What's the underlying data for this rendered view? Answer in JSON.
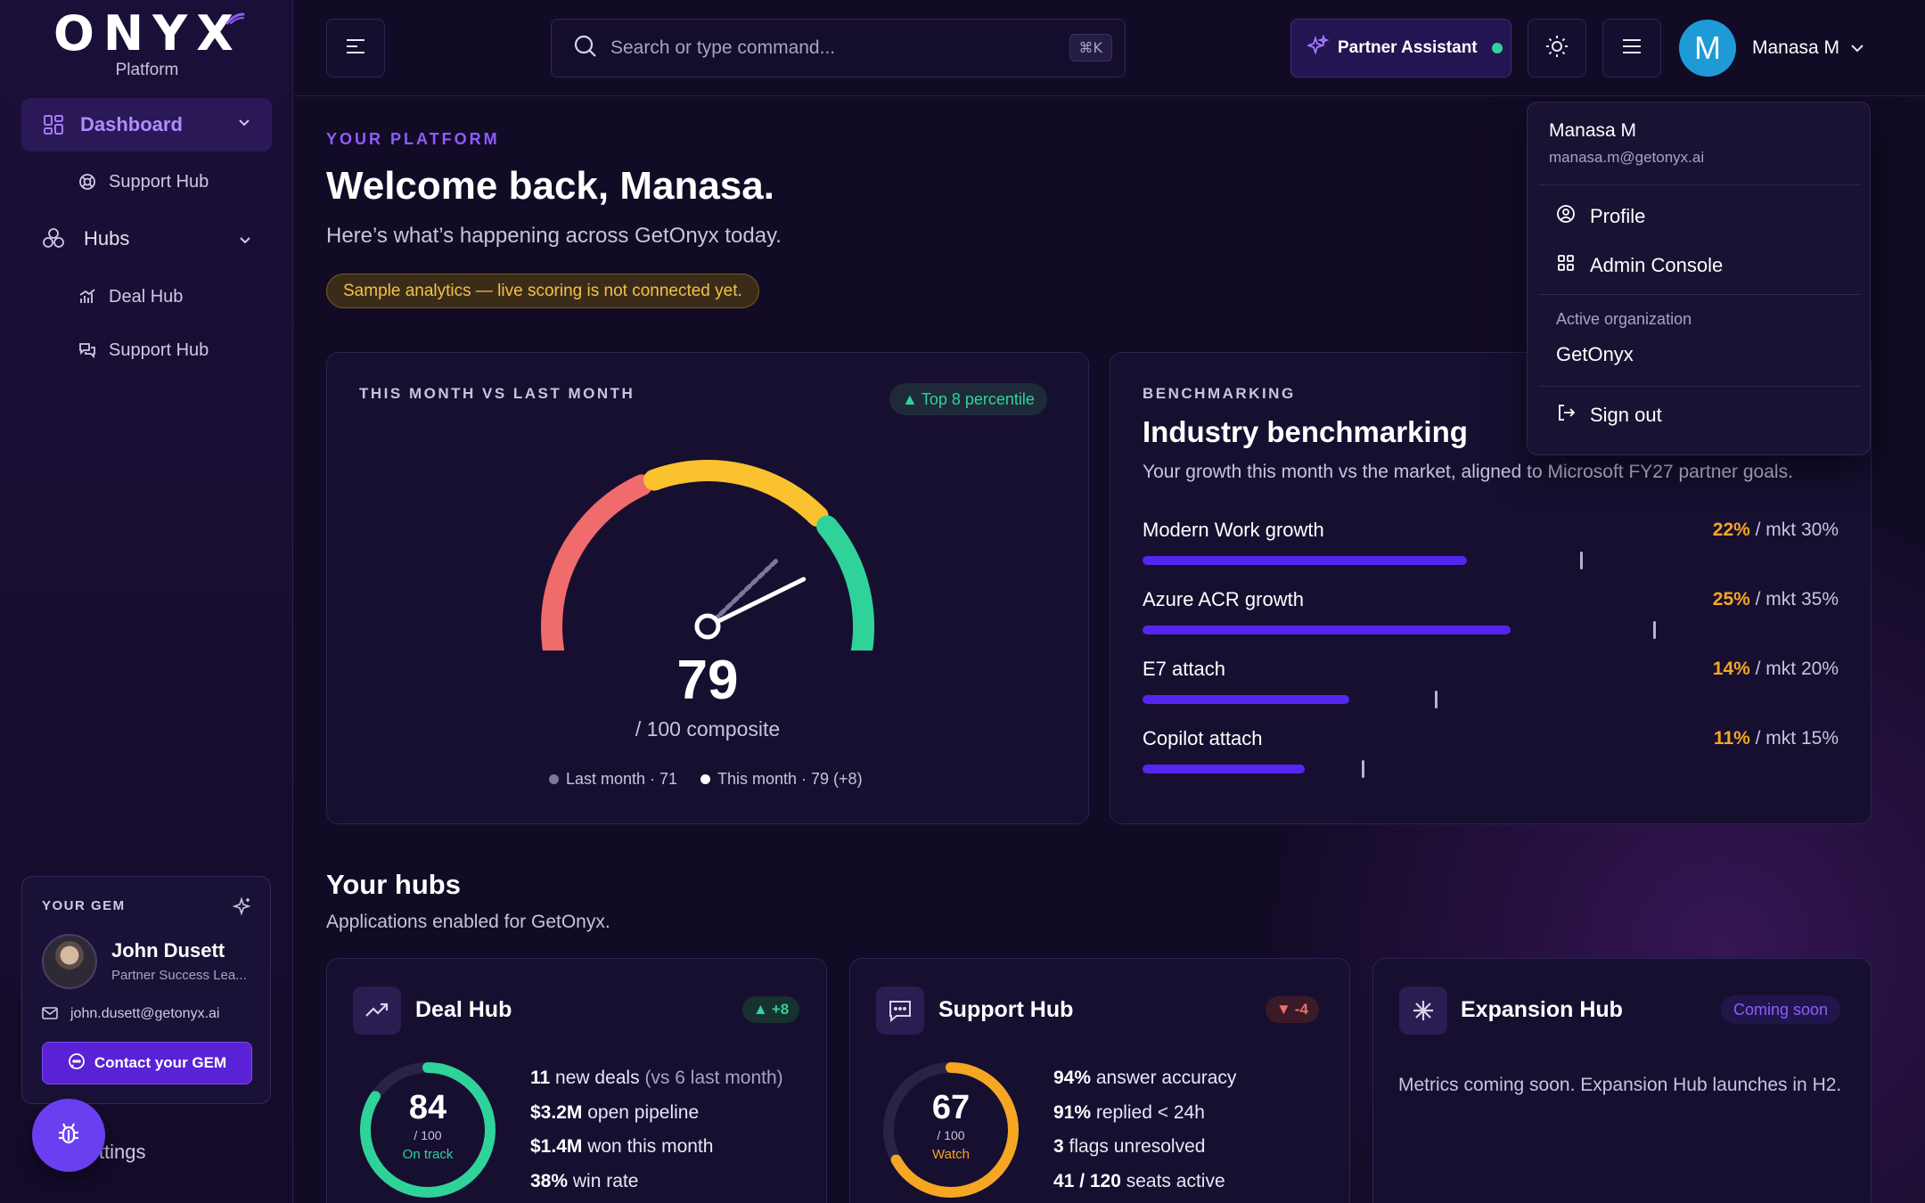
{
  "brand": {
    "name": "ONYX",
    "subtitle": "Platform"
  },
  "sidebar": {
    "items": [
      {
        "label": "Dashboard",
        "icon": "dashboard-grid-icon",
        "active": true
      },
      {
        "label": "Support Hub",
        "icon": "lifebuoy-icon"
      },
      {
        "label": "Hubs",
        "icon": "hubs-cluster-icon"
      },
      {
        "label": "Deal Hub",
        "icon": "bar-chart-icon"
      },
      {
        "label": "Support Hub",
        "icon": "chat-bubbles-icon"
      }
    ],
    "settings_label": "Settings",
    "gem": {
      "title": "YOUR GEM",
      "name": "John Dusett",
      "role": "Partner Success Lea...",
      "email": "john.dusett@getonyx.ai",
      "button": "Contact your GEM"
    }
  },
  "topbar": {
    "search_placeholder": "Search or type command...",
    "shortcut": "⌘K",
    "partner_assistant": "Partner Assistant",
    "user_initial": "M",
    "user_name": "Manasa M"
  },
  "dropdown": {
    "name": "Manasa M",
    "email": "manasa.m@getonyx.ai",
    "profile": "Profile",
    "admin": "Admin Console",
    "org_label": "Active organization",
    "org_name": "GetOnyx",
    "signout": "Sign out"
  },
  "hero": {
    "eyebrow": "YOUR PLATFORM",
    "title": "Welcome back, Manasa.",
    "subtitle": "Here’s what’s happening across GetOnyx today.",
    "notice": "Sample analytics — live scoring is not connected yet."
  },
  "composite": {
    "eyebrow": "THIS MONTH VS LAST MONTH",
    "badge": "Top 8 percentile",
    "score": "79",
    "score_sub": "/ 100 composite",
    "score_value": 79,
    "last_value": 71,
    "legend_last": "Last month · 71",
    "legend_this": "This month · 79 (+8)",
    "colors": {
      "red": "#f06b6b",
      "yellow": "#f9c22e",
      "green": "#2fd39a"
    }
  },
  "benchmark": {
    "eyebrow": "BENCHMARKING",
    "title": "Industry benchmarking",
    "description": "Your growth this month vs the market, aligned to Microsoft FY27 partner goals.",
    "rows": [
      {
        "label": "Modern Work growth",
        "you": "22%",
        "mkt": "/ mkt 30%",
        "you_value": 22,
        "mkt_value": 30
      },
      {
        "label": "Azure ACR growth",
        "you": "25%",
        "mkt": "/ mkt 35%",
        "you_value": 25,
        "mkt_value": 35
      },
      {
        "label": "E7 attach",
        "you": "14%",
        "mkt": "/ mkt 20%",
        "you_value": 14,
        "mkt_value": 20
      },
      {
        "label": "Copilot attach",
        "you": "11%",
        "mkt": "/ mkt 15%",
        "you_value": 11,
        "mkt_value": 15
      }
    ]
  },
  "hubs": {
    "title": "Your hubs",
    "subtitle": "Applications enabled for GetOnyx.",
    "deal": {
      "title": "Deal Hub",
      "delta": "+8",
      "score": "84",
      "of": "/ 100",
      "status": "On track",
      "score_value": 84,
      "metrics": [
        {
          "bold": "11",
          "text": " new deals ",
          "muted": "(vs 6 last month)"
        },
        {
          "bold": "$3.2M",
          "text": " open pipeline",
          "muted": ""
        },
        {
          "bold": "$1.4M",
          "text": " won this month",
          "muted": ""
        },
        {
          "bold": "38%",
          "text": " win rate",
          "muted": ""
        }
      ]
    },
    "support": {
      "title": "Support Hub",
      "delta": "-4",
      "score": "67",
      "of": "/ 100",
      "status": "Watch",
      "score_value": 67,
      "metrics": [
        {
          "bold": "94%",
          "text": " answer accuracy"
        },
        {
          "bold": "91%",
          "text": " replied < 24h"
        },
        {
          "bold": "3",
          "text": " flags unresolved"
        },
        {
          "bold": "41 / 120",
          "text": " seats active"
        }
      ]
    },
    "expansion": {
      "title": "Expansion Hub",
      "badge": "Coming soon",
      "text": "Metrics coming soon. Expansion Hub launches in H2."
    }
  }
}
